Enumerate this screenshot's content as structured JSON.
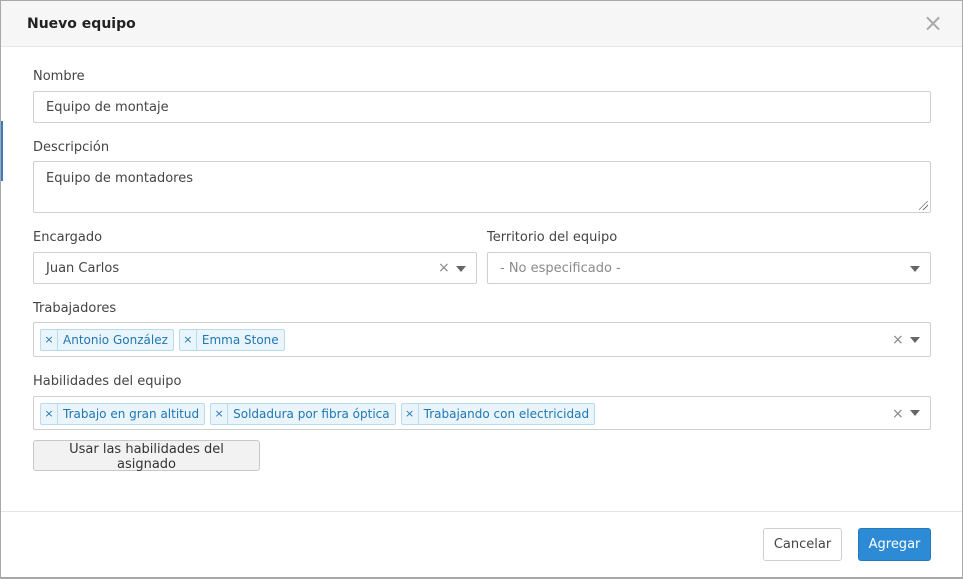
{
  "modal": {
    "title": "Nuevo equipo",
    "close_glyph": "×"
  },
  "form": {
    "name": {
      "label": "Nombre",
      "value": "Equipo de montaje"
    },
    "description": {
      "label": "Descripción",
      "value": "Equipo de montadores"
    },
    "manager": {
      "label": "Encargado",
      "value": "Juan Carlos",
      "clear_glyph": "×"
    },
    "territory": {
      "label": "Territorio del equipo",
      "value": "- No especificado -"
    },
    "workers": {
      "label": "Trabajadores",
      "tags": [
        "Antonio González",
        "Emma Stone"
      ],
      "remove_glyph": "×",
      "clear_glyph": "×"
    },
    "skills": {
      "label": "Habilidades del equipo",
      "tags": [
        "Trabajo en gran altitud",
        "Soldadura por fibra óptica",
        "Trabajando con electricidad"
      ],
      "remove_glyph": "×",
      "clear_glyph": "×"
    },
    "use_assignee_skills_button": "Usar las habilidades del asignado"
  },
  "footer": {
    "cancel_label": "Cancelar",
    "submit_label": "Agregar"
  },
  "colors": {
    "primary": "#2d8ad5",
    "tag_text": "#1f77b4",
    "tag_bg": "#eaf5fb"
  }
}
